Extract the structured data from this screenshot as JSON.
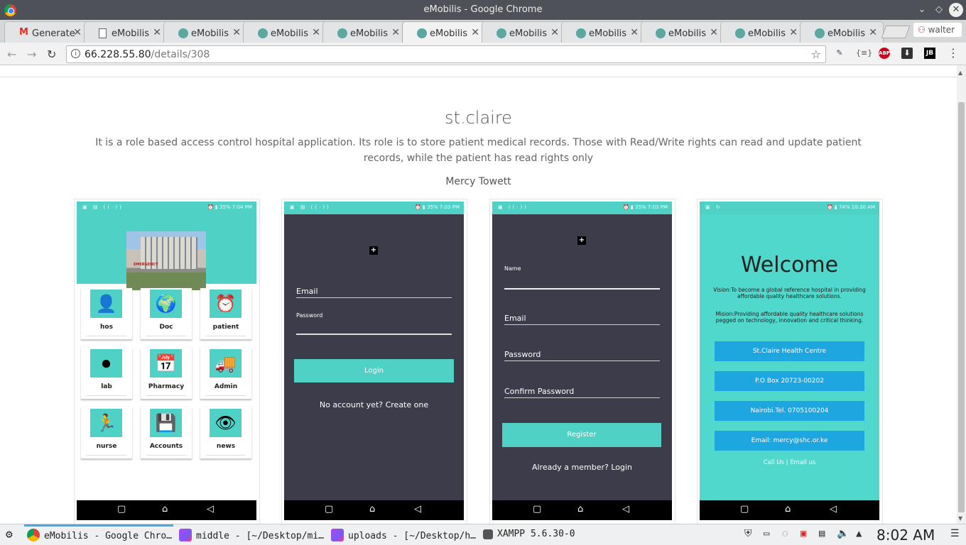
{
  "window": {
    "title": "eMobilis - Google Chrome"
  },
  "tabs": [
    {
      "label": "Generate",
      "icon": "gmail-icon"
    },
    {
      "label": "eMobilis",
      "icon": "document-icon"
    },
    {
      "label": "eMobilis",
      "icon": "emobilis-icon"
    },
    {
      "label": "eMobilis",
      "icon": "emobilis-icon"
    },
    {
      "label": "eMobilis",
      "icon": "emobilis-icon"
    },
    {
      "label": "eMobilis",
      "icon": "emobilis-icon",
      "active": true
    },
    {
      "label": "eMobilis",
      "icon": "emobilis-icon"
    },
    {
      "label": "eMobilis",
      "icon": "emobilis-icon"
    },
    {
      "label": "eMobilis",
      "icon": "emobilis-icon"
    },
    {
      "label": "eMobilis",
      "icon": "emobilis-icon"
    },
    {
      "label": "eMobilis",
      "icon": "emobilis-icon"
    }
  ],
  "profile": {
    "name": "walter"
  },
  "address": {
    "host": "66.228.55.80",
    "path": "/details/308"
  },
  "extensions": {
    "json": "{≡}",
    "abp": "ABP",
    "jb": "JB"
  },
  "page": {
    "title": "st.claire",
    "description": "It is a role based access control hospital application. Its role is to store patient medical records. Those with Read/Write rights can read and update patient records, while the patient has read rights only",
    "author": "Mercy Towett"
  },
  "screens": {
    "status_times": [
      "7:04 PM",
      "7:03 PM",
      "7:03 PM",
      "10:30 AM"
    ],
    "battery": [
      "35%",
      "35%",
      "35%",
      "74%"
    ],
    "dashboard": {
      "hospital_sign": "EMERGENCY",
      "tiles": [
        {
          "label": "hos",
          "icon": "user-key-icon",
          "glyph": "👤"
        },
        {
          "label": "Doc",
          "icon": "globe-icon",
          "glyph": "🌍"
        },
        {
          "label": "patient",
          "icon": "alarm-clock-icon",
          "glyph": "⏰"
        },
        {
          "label": "lab",
          "icon": "toggle-icon",
          "glyph": "⏺"
        },
        {
          "label": "Pharmacy",
          "icon": "calendar-clock-icon",
          "glyph": "📅"
        },
        {
          "label": "Admin",
          "icon": "delivery-truck-icon",
          "glyph": "🚚"
        },
        {
          "label": "nurse",
          "icon": "exit-runner-icon",
          "glyph": "🏃"
        },
        {
          "label": "Accounts",
          "icon": "floppy-disks-icon",
          "glyph": "💾"
        },
        {
          "label": "news",
          "icon": "eye-icon",
          "glyph": "👁"
        }
      ]
    },
    "login": {
      "email_label": "Email",
      "password_label": "Password",
      "button": "Login",
      "create_link": "No account yet? Create one"
    },
    "register": {
      "name_label": "Name",
      "email_label": "Email",
      "password_label": "Password",
      "confirm_label": "Confirm Password",
      "button": "Register",
      "login_link": "Already a member? Login"
    },
    "welcome": {
      "heading": "Welcome",
      "vision": "Vision:To become a global reference hospital in providing affordable quality healthcare solutions.",
      "mission": "Mision:Providing affordable quality healthcare solutions pegged on technology, innovation and critical thinking.",
      "buttons": [
        "St.Claire Health Centre",
        "P.O Box 20723-00202",
        "Nairobi.Tel. 0705100204",
        "Email: mercy@shc.or.ke"
      ],
      "footer": "Call Us | Email us"
    }
  },
  "taskbar": {
    "items": [
      {
        "label": "eMobilis - Google Chro…",
        "icon": "chrome-icon"
      },
      {
        "label": "middle - [~/Desktop/mi…",
        "icon": "phpstorm-icon"
      },
      {
        "label": "uploads - [~/Desktop/h…",
        "icon": "phpstorm-icon"
      },
      {
        "label": "XAMPP 5.6.30-0",
        "icon": "xampp-icon"
      }
    ],
    "clock": "8:02 AM"
  },
  "colors": {
    "teal": "#4fd1c5",
    "dark_screen": "#3d3c4a",
    "welcome_button": "#1ea6e0"
  }
}
